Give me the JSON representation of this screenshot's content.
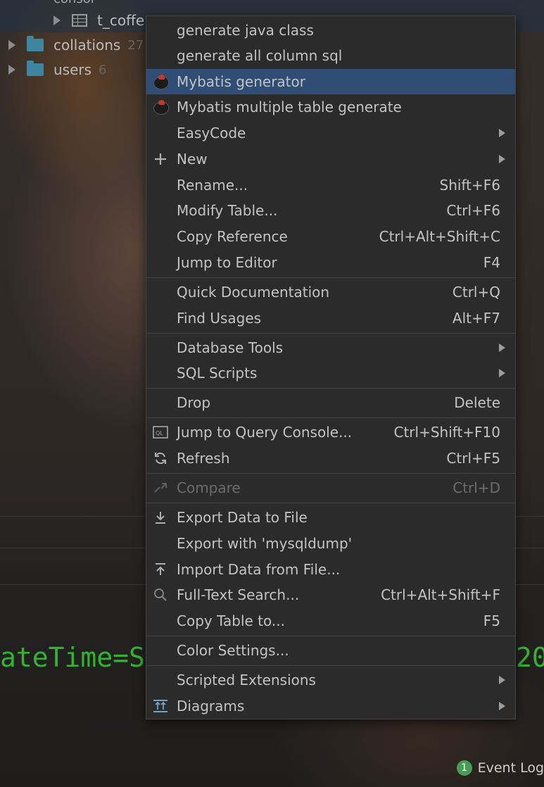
{
  "tree": {
    "partial_top_label": "consol",
    "table_row": {
      "label": "t_coffe"
    },
    "rows": [
      {
        "label": "collations",
        "count": "27"
      },
      {
        "label": "users",
        "count": "6"
      }
    ]
  },
  "console": {
    "text_left": "ateTime=Sa",
    "text_right": "20"
  },
  "status_bar": {
    "event_log_badge": "1",
    "event_log_label": "Event Log"
  },
  "menu": {
    "items": [
      {
        "label": "generate java class",
        "shortcut": "",
        "icon": "",
        "submenu": false
      },
      {
        "label": "generate all column sql",
        "shortcut": "",
        "icon": "",
        "submenu": false
      },
      {
        "label": "Mybatis generator",
        "shortcut": "",
        "icon": "mybatis-bird-icon",
        "submenu": false,
        "selected": true
      },
      {
        "label": "Mybatis multiple table generate",
        "shortcut": "",
        "icon": "mybatis-bird-icon",
        "submenu": false
      },
      {
        "label": "EasyCode",
        "shortcut": "",
        "icon": "",
        "submenu": true
      },
      {
        "label": "New",
        "shortcut": "",
        "icon": "plus-icon",
        "submenu": true
      },
      {
        "label": "Rename...",
        "shortcut": "Shift+F6",
        "icon": "",
        "submenu": false
      },
      {
        "label": "Modify Table...",
        "shortcut": "Ctrl+F6",
        "icon": "",
        "submenu": false
      },
      {
        "label": "Copy Reference",
        "shortcut": "Ctrl+Alt+Shift+C",
        "icon": "",
        "submenu": false
      },
      {
        "label": "Jump to Editor",
        "shortcut": "F4",
        "icon": "",
        "submenu": false
      },
      {
        "label": "Quick Documentation",
        "shortcut": "Ctrl+Q",
        "icon": "",
        "submenu": false
      },
      {
        "label": "Find Usages",
        "shortcut": "Alt+F7",
        "icon": "",
        "submenu": false
      },
      {
        "label": "Database Tools",
        "shortcut": "",
        "icon": "",
        "submenu": true
      },
      {
        "label": "SQL Scripts",
        "shortcut": "",
        "icon": "",
        "submenu": true
      },
      {
        "label": "Drop",
        "shortcut": "Delete",
        "icon": "",
        "submenu": false
      },
      {
        "label": "Jump to Query Console...",
        "shortcut": "Ctrl+Shift+F10",
        "icon": "query-console-icon",
        "submenu": false
      },
      {
        "label": "Refresh",
        "shortcut": "Ctrl+F5",
        "icon": "refresh-icon",
        "submenu": false
      },
      {
        "label": "Compare",
        "shortcut": "Ctrl+D",
        "icon": "compare-icon",
        "submenu": false,
        "disabled": true
      },
      {
        "label": "Export Data to File",
        "shortcut": "",
        "icon": "export-icon",
        "submenu": false
      },
      {
        "label": "Export with 'mysqldump'",
        "shortcut": "",
        "icon": "",
        "submenu": false
      },
      {
        "label": "Import Data from File...",
        "shortcut": "",
        "icon": "import-icon",
        "submenu": false
      },
      {
        "label": "Full-Text Search...",
        "shortcut": "Ctrl+Alt+Shift+F",
        "icon": "search-icon",
        "submenu": false
      },
      {
        "label": "Copy Table to...",
        "shortcut": "F5",
        "icon": "",
        "submenu": false
      },
      {
        "label": "Color Settings...",
        "shortcut": "",
        "icon": "",
        "submenu": false
      },
      {
        "label": "Scripted Extensions",
        "shortcut": "",
        "icon": "",
        "submenu": true
      },
      {
        "label": "Diagrams",
        "shortcut": "",
        "icon": "diagram-icon",
        "submenu": true
      }
    ]
  }
}
